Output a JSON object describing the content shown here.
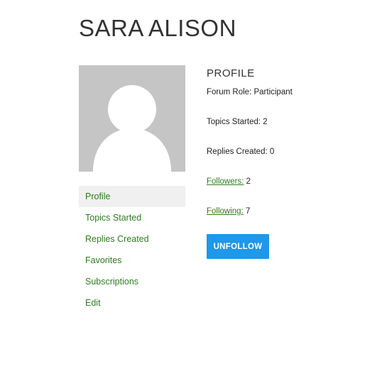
{
  "user": {
    "display_name": "SARA ALISON"
  },
  "nav": {
    "items": [
      {
        "label": "Profile",
        "active": true
      },
      {
        "label": "Topics Started"
      },
      {
        "label": "Replies Created"
      },
      {
        "label": "Favorites"
      },
      {
        "label": "Subscriptions"
      },
      {
        "label": "Edit"
      }
    ]
  },
  "profile": {
    "title": "PROFILE",
    "forum_role_label": "Forum Role:",
    "forum_role_value": "Participant",
    "topics_started_label": "Topics Started:",
    "topics_started_value": "2",
    "replies_created_label": "Replies Created:",
    "replies_created_value": "0",
    "followers_label": "Followers:",
    "followers_value": "2",
    "following_label": "Following:",
    "following_value": "7",
    "unfollow_label": "UNFOLLOW"
  },
  "colors": {
    "link_green": "#2e7d1e",
    "button_blue": "#1e98ea",
    "avatar_gray": "#c5c5c5",
    "active_bg": "#f0f0f0"
  },
  "icons": {
    "avatar": "default-user-silhouette-icon"
  }
}
